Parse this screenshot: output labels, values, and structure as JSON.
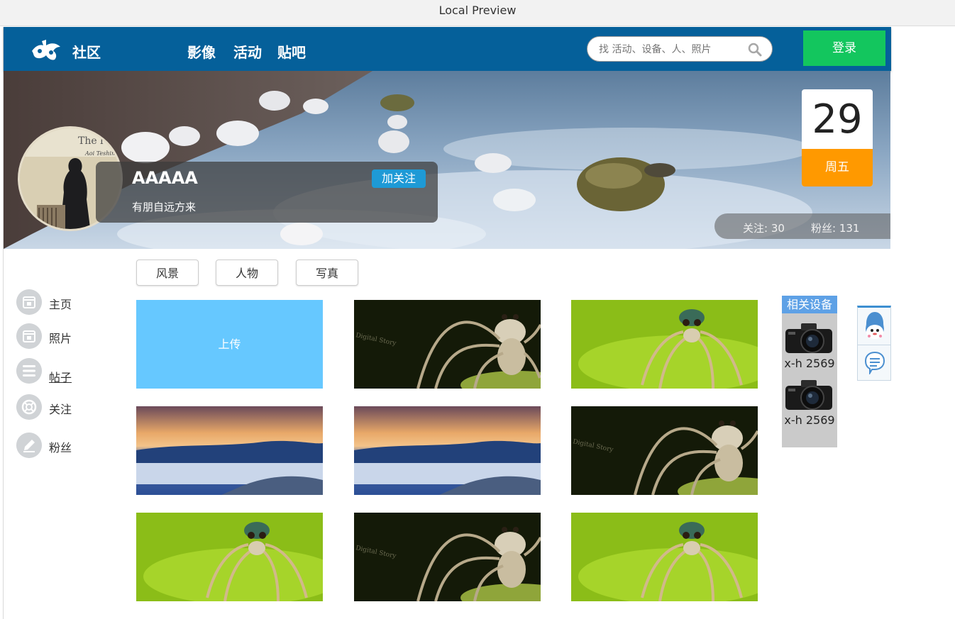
{
  "window": {
    "title": "Local Preview"
  },
  "header": {
    "logo_text": "社区",
    "nav": [
      "影像",
      "活动",
      "贴吧"
    ],
    "search_placeholder": "找 活动、设备、人、照片",
    "login_label": "登录"
  },
  "profile": {
    "name": "AAAAA",
    "motto": "有朋自远方来",
    "follow_label": "加关注",
    "avatar_text": "The l",
    "avatar_subtext": "Aoi Teshima"
  },
  "date": {
    "day": "29",
    "weekday": "周五"
  },
  "stats": {
    "following": "关注: 30",
    "fans": "粉丝: 131"
  },
  "sidebar": {
    "items": [
      {
        "label": "主页",
        "icon": "calendar-icon"
      },
      {
        "label": "照片",
        "icon": "calendar-icon"
      },
      {
        "label": "帖子",
        "icon": "menu-icon"
      },
      {
        "label": "关注",
        "icon": "lifebuoy-icon"
      },
      {
        "label": "粉丝",
        "icon": "pencil-icon"
      }
    ],
    "active": "帖子"
  },
  "categories": [
    "风景",
    "人物",
    "写真"
  ],
  "gallery": {
    "upload_label": "上传",
    "watermark": "Digital Story",
    "tiles": [
      "upload",
      "spider-dark",
      "spider-green",
      "sunset",
      "sunset",
      "spider-dark",
      "spider-green",
      "spider-dark",
      "spider-green"
    ]
  },
  "equipment": {
    "title": "相关设备",
    "items": [
      "x-h 2569",
      "x-h 2569"
    ]
  },
  "colors": {
    "header": "#05609a",
    "login": "#13c65e",
    "follow": "#1e9ad6",
    "weekday": "#ff9900",
    "upload": "#66c8ff",
    "equipment_title": "#5ea1e6"
  }
}
